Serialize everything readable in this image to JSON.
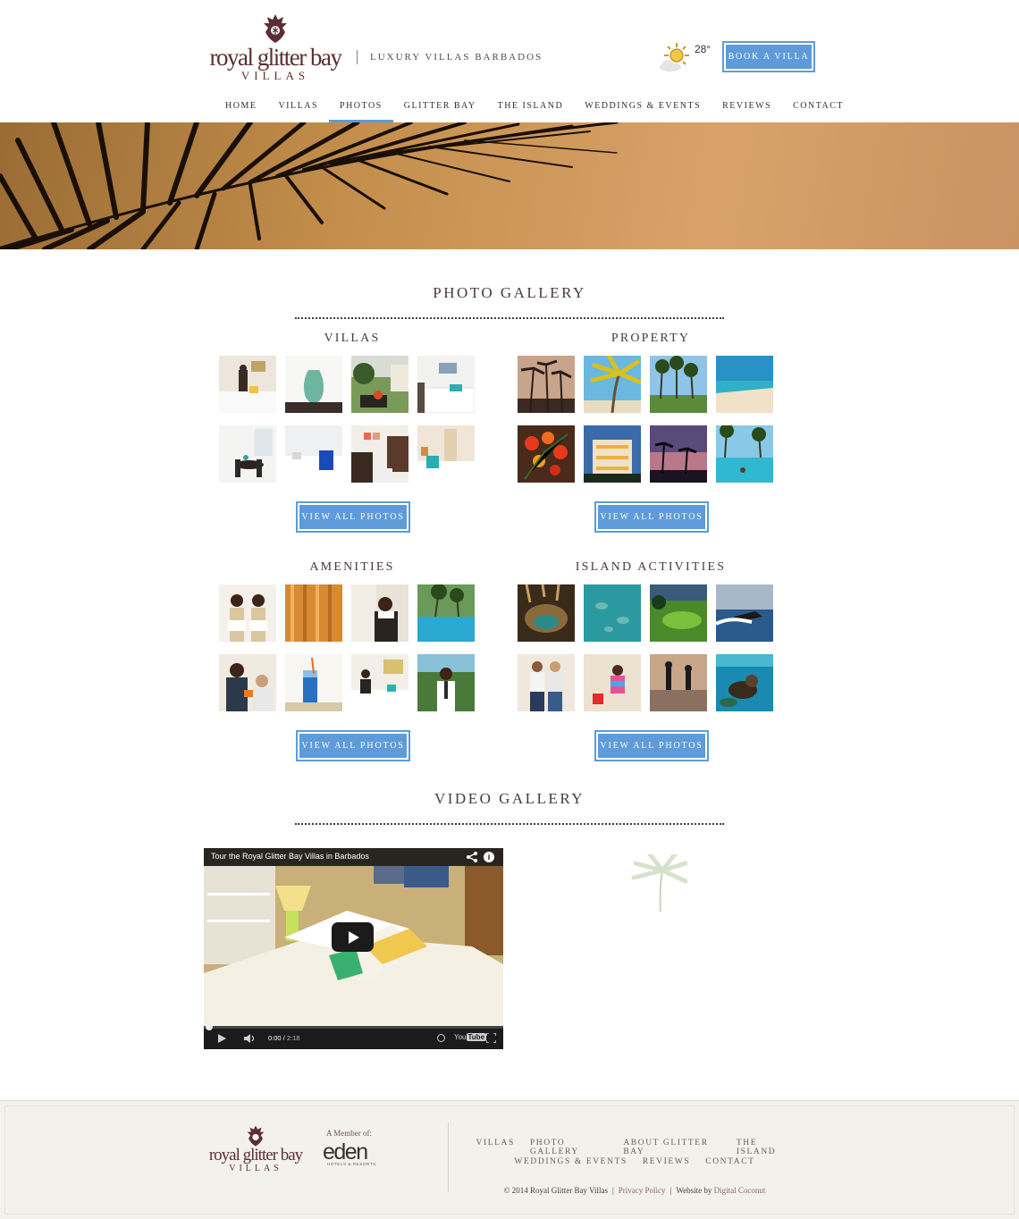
{
  "header": {
    "logo_name": "royal glitter bay",
    "logo_sub": "VILLAS",
    "tagline": "LUXURY VILLAS BARBADOS",
    "temperature": "28°",
    "book_label": "BOOK A VILLA",
    "weather_icon": "partly-cloudy-sun-icon"
  },
  "nav": {
    "active": "PHOTOS",
    "items": [
      "HOME",
      "VILLAS",
      "PHOTOS",
      "GLITTER BAY",
      "THE ISLAND",
      "WEDDINGS & EVENTS",
      "REVIEWS",
      "CONTACT"
    ]
  },
  "photo_gallery": {
    "title": "PHOTO GALLERY",
    "view_all_label": "VIEW ALL PHOTOS",
    "categories": [
      {
        "title": "VILLAS",
        "thumbs": [
          "villa-bedroom-staff",
          "vase",
          "villa-exterior",
          "bedroom-teal",
          "dining-room",
          "bedroom-blue",
          "living-room",
          "bedroom-pillows"
        ]
      },
      {
        "title": "PROPERTY",
        "thumbs": [
          "palm-trees",
          "palm-beach",
          "golf-palms",
          "beach",
          "flowers",
          "building-night",
          "sunset-palms",
          "pool"
        ]
      },
      {
        "title": "AMENITIES",
        "thumbs": [
          "staff-towels",
          "curtains",
          "housekeeper",
          "pool-lounge",
          "bar-staff",
          "cocktail",
          "maid-room",
          "butler"
        ]
      },
      {
        "title": "ISLAND ACTIVITIES",
        "thumbs": [
          "cave",
          "turtles",
          "golf-course",
          "jet-ski",
          "shopping",
          "child-beach",
          "paddleboard",
          "snorkel"
        ]
      }
    ]
  },
  "video_gallery": {
    "title": "VIDEO GALLERY",
    "video_title": "Tour the Royal Glitter Bay Villas in Barbados",
    "time_current": "0:00",
    "time_total": "2:18",
    "youtube_label": "You",
    "youtube_tube": "Tube",
    "info": "i"
  },
  "footer": {
    "logo_name": "royal glitter bay",
    "logo_sub": "VILLAS",
    "member_label": "A Member of:",
    "eden_name": "eden",
    "eden_sub": "HOTELS & RESORTS",
    "links_row1": [
      "VILLAS",
      "PHOTO GALLERY",
      "ABOUT GLITTER BAY",
      "THE ISLAND"
    ],
    "links_row2": [
      "WEDDINGS & EVENTS",
      "REVIEWS",
      "CONTACT"
    ],
    "copyright": "© 2014 Royal Glitter Bay Villas",
    "privacy": "Privacy Policy",
    "website_by": "Website by",
    "agency": "Digital Coconut",
    "sep": "|"
  },
  "colors": {
    "accent": "#5e9bd8",
    "brand": "#5b2e35",
    "text": "#4a3b3b",
    "footer_bg": "#f3f1ec"
  }
}
